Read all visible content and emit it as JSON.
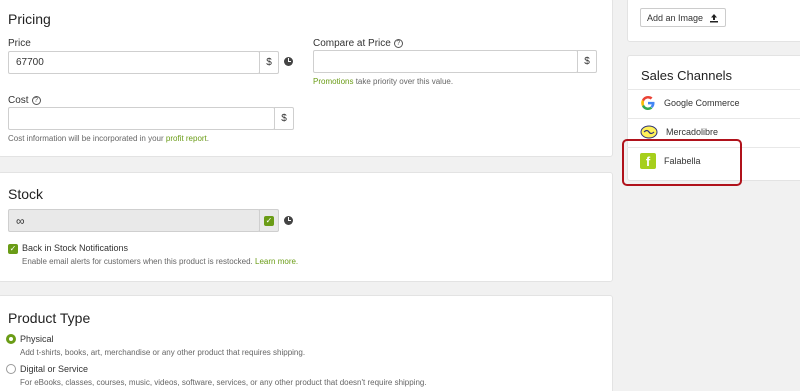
{
  "pricing": {
    "title": "Pricing",
    "price_label": "Price",
    "price_value": "67700",
    "currency": "$",
    "compare_label": "Compare at Price",
    "compare_currency": "$",
    "promo_link": "Promotions",
    "promo_note": "take priority over this value.",
    "cost_label": "Cost",
    "cost_currency": "$",
    "cost_note": "Cost information will be incorporated in your",
    "cost_link": "profit report",
    "cost_end": "."
  },
  "stock": {
    "title": "Stock",
    "value": "∞",
    "back_label": "Back in Stock Notifications",
    "back_note": "Enable email alerts for customers when this product is restocked.",
    "learn_more": "Learn more."
  },
  "product_type": {
    "title": "Product Type",
    "physical_label": "Physical",
    "physical_desc": "Add t-shirts, books, art, merchandise or any other product that requires shipping.",
    "digital_label": "Digital or Service",
    "digital_desc": "For eBooks, classes, courses, music, videos, software, services, or any other product that doesn't require shipping."
  },
  "sidebar": {
    "add_image": "Add an Image",
    "sales_title": "Sales Channels",
    "channels": [
      {
        "name": "Google Commerce",
        "icon": "google-icon"
      },
      {
        "name": "Mercadolibre",
        "icon": "mercadolibre-icon"
      },
      {
        "name": "Falabella",
        "icon": "falabella-icon"
      }
    ]
  },
  "colors": {
    "accent": "#6a9c16",
    "highlight": "#b0121b",
    "falabella": "#a6cf1b"
  }
}
